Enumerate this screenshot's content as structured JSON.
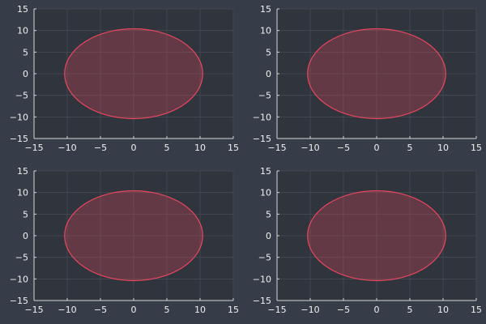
{
  "figure": {
    "background": "#373d48",
    "plot_background": "#30343c",
    "grid_color": "#454b55",
    "axis_color": "#d6d6d6",
    "text_color": "#f0f0f0"
  },
  "chart_data": [
    {
      "type": "area",
      "shape": "ellipse",
      "title": "",
      "xlabel": "",
      "ylabel": "",
      "xlim": [
        -15,
        15
      ],
      "ylim": [
        -15,
        15
      ],
      "xticks": [
        -15,
        -10,
        -5,
        0,
        5,
        10,
        15
      ],
      "yticks": [
        -15,
        -10,
        -5,
        0,
        5,
        10,
        15
      ],
      "grid": true,
      "legend": "none",
      "series": [
        {
          "center": [
            0,
            0
          ],
          "radius_x": 10.4,
          "radius_y": 10.4,
          "color": "#e8475f",
          "fill_opacity": 0.28
        }
      ]
    },
    {
      "type": "area",
      "shape": "ellipse",
      "title": "",
      "xlabel": "",
      "ylabel": "",
      "xlim": [
        -15,
        15
      ],
      "ylim": [
        -15,
        15
      ],
      "xticks": [
        -15,
        -10,
        -5,
        0,
        5,
        10,
        15
      ],
      "yticks": [
        -15,
        -10,
        -5,
        0,
        5,
        10,
        15
      ],
      "grid": true,
      "legend": "none",
      "series": [
        {
          "center": [
            0,
            0
          ],
          "radius_x": 10.4,
          "radius_y": 10.4,
          "color": "#e8475f",
          "fill_opacity": 0.28
        }
      ]
    },
    {
      "type": "area",
      "shape": "ellipse",
      "title": "",
      "xlabel": "",
      "ylabel": "",
      "xlim": [
        -15,
        15
      ],
      "ylim": [
        -15,
        15
      ],
      "xticks": [
        -15,
        -10,
        -5,
        0,
        5,
        10,
        15
      ],
      "yticks": [
        -15,
        -10,
        -5,
        0,
        5,
        10,
        15
      ],
      "grid": true,
      "legend": "none",
      "series": [
        {
          "center": [
            0,
            0
          ],
          "radius_x": 10.4,
          "radius_y": 10.4,
          "color": "#e8475f",
          "fill_opacity": 0.28
        }
      ]
    },
    {
      "type": "area",
      "shape": "ellipse",
      "title": "",
      "xlabel": "",
      "ylabel": "",
      "xlim": [
        -15,
        15
      ],
      "ylim": [
        -15,
        15
      ],
      "xticks": [
        -15,
        -10,
        -5,
        0,
        5,
        10,
        15
      ],
      "yticks": [
        -15,
        -10,
        -5,
        0,
        5,
        10,
        15
      ],
      "grid": true,
      "legend": "none",
      "series": [
        {
          "center": [
            0,
            0
          ],
          "radius_x": 10.4,
          "radius_y": 10.4,
          "color": "#e8475f",
          "fill_opacity": 0.28
        }
      ]
    }
  ]
}
